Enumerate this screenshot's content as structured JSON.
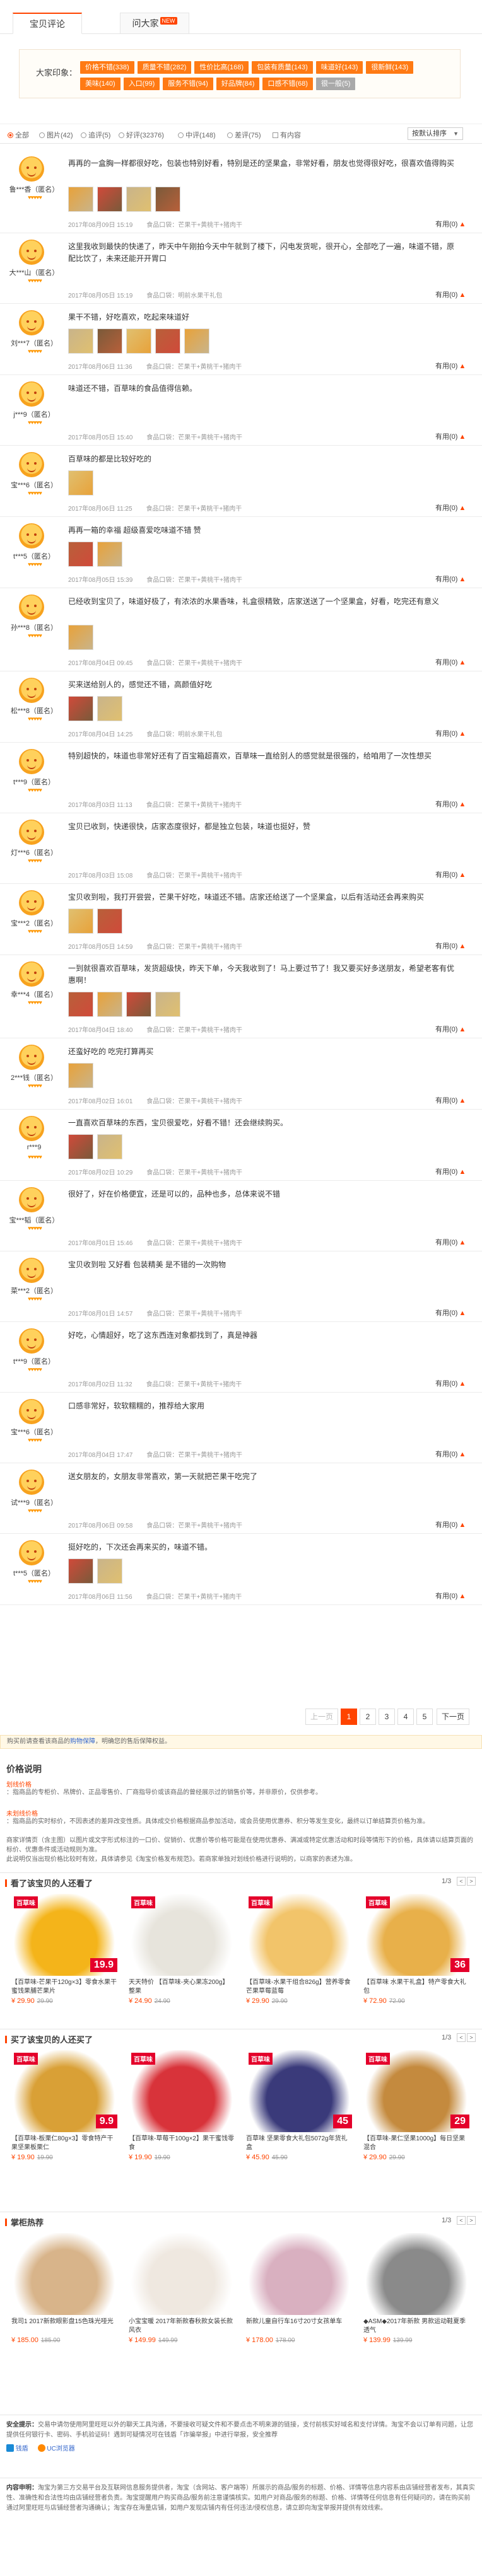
{
  "tabs": {
    "reviews": "宝贝评论",
    "rate": "问大家",
    "new_badge": "NEW"
  },
  "impression": {
    "label": "大家印象：",
    "chips": [
      {
        "text": "价格不错(338)"
      },
      {
        "text": "质量不错(282)"
      },
      {
        "text": "性价比高(168)"
      },
      {
        "text": "包装有质量(143)"
      },
      {
        "text": "味道好(143)"
      },
      {
        "text": "很新鲜(143)"
      },
      {
        "text": "美味(140)"
      },
      {
        "text": "入口(99)"
      },
      {
        "text": "服务不错(94)"
      },
      {
        "text": "好品牌(84)"
      },
      {
        "text": "口感不错(68)"
      },
      {
        "text": "很一般(5)",
        "bad": true
      }
    ]
  },
  "filter": {
    "all": "全部",
    "pic": "图片(42)",
    "append": "追评(5)",
    "good": "好评(32376)",
    "mid": "中评(148)",
    "bad": "差评(75)",
    "has_content": "有内容",
    "sort": "按默认排序"
  },
  "reviews": [
    {
      "nick": "鲁***香（匿名）",
      "text": "再再的一盒胸一样都很好吃，包装也特别好看，特别是还的坚果盒，非常好看，朋友也觉得很好吃，很喜欢值得购买",
      "photos": 4,
      "date": "2017年08月09日 15:19",
      "sku": "食品口袋：芒果干+黄桃干+猪肉干",
      "extra": "",
      "useful": "有用(0)"
    },
    {
      "nick": "大***山（匿名）",
      "text": "这里我收到最快的快递了，昨天中午刚拍今天中午就到了楼下，闪电发货呢，很开心，全部吃了一遍，味道不错，原配比饮了，未来还能开开胃口",
      "photos": 0,
      "date": "2017年08月05日 15:19",
      "sku": "食品口袋：明前水果干礼包",
      "extra": "",
      "useful": "有用(0)"
    },
    {
      "nick": "刘***7（匿名）",
      "text": "果干不错，好吃喜欢，吃起来味道好",
      "photos": 5,
      "date": "2017年08月06日 11:36",
      "sku": "食品口袋：芒果干+黄桃干+猪肉干",
      "extra": "",
      "useful": "有用(0)"
    },
    {
      "nick": "j***9（匿名）",
      "text": "味道还不错，百草味的食品值得信赖。",
      "photos": 0,
      "date": "2017年08月05日 15:40",
      "sku": "食品口袋：芒果干+黄桃干+猪肉干",
      "extra": "",
      "useful": "有用(0)"
    },
    {
      "nick": "宝***6（匿名）",
      "text": "百草味的都是比较好吃的",
      "photos": 1,
      "date": "2017年08月06日 11:25",
      "sku": "食品口袋：芒果干+黄桃干+猪肉干",
      "extra": "",
      "useful": "有用(0)"
    },
    {
      "nick": "t***5（匿名）",
      "text": "再再一箱的幸福 超级喜爱吃味道不错 赞",
      "photos": 2,
      "date": "2017年08月05日 15:39",
      "sku": "食品口袋：芒果干+黄桃干+猪肉干",
      "extra": "",
      "useful": "有用(0)"
    },
    {
      "nick": "孙***8（匿名）",
      "text": "已经收到宝贝了，味道好极了，有浓浓的水果香味，礼盒很精致，店家送送了一个坚果盒，好看，吃完还有意义",
      "photos": 1,
      "date": "2017年08月04日 09:45",
      "sku": "食品口袋：芒果干+黄桃干+猪肉干",
      "extra": "",
      "useful": "有用(0)"
    },
    {
      "nick": "松***8（匿名）",
      "text": "买来送给别人的，感觉还不错，高颜值好吃",
      "photos": 2,
      "date": "2017年08月04日 14:25",
      "sku": "食品口袋：明前水果干礼包",
      "extra": "",
      "useful": "有用(0)"
    },
    {
      "nick": "t***9（匿名）",
      "text": "特别超快的，味道也非常好还有了百宝箱超喜欢，百草味一直给别人的感觉就是很强的，给咱用了一次性想买",
      "photos": 0,
      "date": "2017年08月03日 11:13",
      "sku": "食品口袋：芒果干+黄桃干+猪肉干",
      "extra": "",
      "useful": "有用(0)"
    },
    {
      "nick": "灯***6（匿名）",
      "text": "宝贝已收到，快递很快，店家态度很好，都是独立包装，味道也挺好，赞",
      "photos": 0,
      "date": "2017年08月03日 15:08",
      "sku": "食品口袋：芒果干+黄桃干+猪肉干",
      "extra": "",
      "useful": "有用(0)"
    },
    {
      "nick": "宝***2（匿名）",
      "text": "宝贝收到啦，我打开尝尝，芒果干好吃，味道还不错。店家还给送了一个坚果盒，以后有活动还会再来购买",
      "photos": 2,
      "date": "2017年08月05日 14:59",
      "sku": "食品口袋：芒果干+黄桃干+猪肉干",
      "extra": "",
      "useful": "有用(0)"
    },
    {
      "nick": "幸***4（匿名）",
      "text": "一到就很喜欢百草味，发货超级快，昨天下单，今天我收到了！马上要过节了！我又要买好多送朋友，希望老客有优惠啊！",
      "photos": 4,
      "date": "2017年08月04日 18:40",
      "sku": "食品口袋：芒果干+黄桃干+猪肉干",
      "extra": "",
      "useful": "有用(0)"
    },
    {
      "nick": "2***钱（匿名）",
      "text": "还蛮好吃的 吃完打算再买",
      "photos": 1,
      "date": "2017年08月02日 16:01",
      "sku": "食品口袋：芒果干+黄桃干+猪肉干",
      "extra": "",
      "useful": "有用(0)"
    },
    {
      "nick": "r***9",
      "text": "一直喜欢百草味的东西，宝贝很爱吃，好看不错！还会继续购买。",
      "photos": 2,
      "date": "2017年08月02日 10:29",
      "sku": "食品口袋：芒果干+黄桃干+猪肉干",
      "extra": "",
      "useful": "有用(0)"
    },
    {
      "nick": "宝***韬（匿名）",
      "text": "很好了，好在价格便宜，还是可以的，品种也多，总体来说不错",
      "photos": 0,
      "date": "2017年08月01日 15:46",
      "sku": "食品口袋：芒果干+黄桃干+猪肉干",
      "extra": "",
      "useful": "有用(0)"
    },
    {
      "nick": "菜***2（匿名）",
      "text": "宝贝收到啦 又好看 包装精美 是不错的一次购物",
      "photos": 0,
      "date": "2017年08月01日 14:57",
      "sku": "食品口袋：芒果干+黄桃干+猪肉干",
      "extra": "",
      "useful": "有用(0)"
    },
    {
      "nick": "t***9（匿名）",
      "text": "好吃，心情超好，吃了这东西连对象都找到了，真是神器",
      "photos": 0,
      "date": "2017年08月02日 11:32",
      "sku": "食品口袋：芒果干+黄桃干+猪肉干",
      "extra": "",
      "useful": "有用(0)"
    },
    {
      "nick": "宝***6（匿名）",
      "text": "口感非常好，软软糯糯的，推荐给大家用",
      "photos": 0,
      "date": "2017年08月04日 17:47",
      "sku": "食品口袋：芒果干+黄桃干+猪肉干",
      "extra": "",
      "useful": "有用(0)"
    },
    {
      "nick": "试***9（匿名）",
      "text": "送女朋友的，女朋友非常喜欢，第一天就把芒果干吃完了",
      "photos": 0,
      "date": "2017年08月06日 09:58",
      "sku": "食品口袋：芒果干+黄桃干+猪肉干",
      "extra": "",
      "useful": "有用(0)"
    },
    {
      "nick": "t***5（匿名）",
      "text": "挺好吃的，下次还会再来买的，味道不错。",
      "photos": 2,
      "date": "2017年08月06日 11:56",
      "sku": "食品口袋：芒果干+黄桃干+猪肉干",
      "extra": "",
      "useful": "有用(0)"
    }
  ],
  "pager": {
    "prev": "上一页",
    "pages": [
      "1",
      "2",
      "3",
      "4",
      "5"
    ],
    "next": "下一页"
  },
  "notice": {
    "text": "购买前请查看该商品的",
    "link1": "购物保障",
    "mid": "，明确您的售后保障权益。"
  },
  "price_explain": {
    "title": "价格说明",
    "a_label": "划线价格",
    "a_text": "：指商品的专柜价、吊牌价、正品零售价、厂商指导价或该商品的曾经展示过的销售价等，并非原价，仅供参考。",
    "b_label": "未划线价格",
    "b_text": "：指商品的实时标价，不因表述的差异改变性质。具体成交价格根据商品参加活动，或会员使用优惠券、积分等发生变化，最终以订单结算页价格为准。",
    "c_text": "商家详情页（含主图）以图片或文字形式标注的一口价、促销价、优惠价等价格可能是在使用优惠券、满减或特定优惠活动和时段等情形下的价格，具体请以结算页面的标价、优惠条件或活动规则为准。",
    "d_text": "此说明仅当出现价格比较时有效，具体请参见《淘宝价格发布规范》。若商家单独对划线价格进行说明的，以商家的表述为准。"
  },
  "sec_viewed": {
    "title": "看了该宝贝的人还看了",
    "page": "1/3"
  },
  "viewed": [
    {
      "name": "【百草味-芒果干120g×3】零食水果干蜜饯果脯芒果片",
      "price": "¥ 29.90",
      "old": "29.90",
      "tag": "19.9",
      "bg": "#f4b41a"
    },
    {
      "name": "天天特价 【百草味-夹心果冻200g】整果",
      "price": "¥ 24.90",
      "old": "24.90",
      "tag": "",
      "bg": "#e7e4dc"
    },
    {
      "name": "【百草味-水果干组合826g】营养零食芒果草莓蓝莓",
      "price": "¥ 29.90",
      "old": "29.90",
      "tag": "",
      "bg": "#f2c46a"
    },
    {
      "name": "【百草味 水果干礼盒】特产零食大礼包",
      "price": "¥ 72.90",
      "old": "72.90",
      "tag": "36",
      "bg": "#e8b04a"
    }
  ],
  "sec_bought": {
    "title": "买了该宝贝的人还买了",
    "page": "1/3"
  },
  "bought": [
    {
      "name": "【百草味-板栗仁80g×3】零食特产干果坚果板栗仁",
      "price": "¥ 19.90",
      "old": "19.90",
      "tag": "9.9",
      "bg": "#d9a036"
    },
    {
      "name": "【百草味-草莓干100g×2】果干蜜饯零食",
      "price": "¥ 19.90",
      "old": "19.90",
      "tag": "",
      "bg": "#d8333a"
    },
    {
      "name": "百草味 坚果零食大礼包5072g年货礼盒",
      "price": "¥ 45.90",
      "old": "45.90",
      "tag": "45",
      "bg": "#3a3a7a"
    },
    {
      "name": "【百草味-果仁坚果1000g】每日坚果混合",
      "price": "¥ 29.90",
      "old": "29.90",
      "tag": "29",
      "bg": "#c48a3e"
    }
  ],
  "sec_hot": {
    "title": "掌柜热荐",
    "page": "1/3"
  },
  "hot": [
    {
      "name": "我司1 2017新款眼影盘15色珠光哑光",
      "price": "¥ 185.00",
      "old": "185.00",
      "bg": "#d8b48a"
    },
    {
      "name": "小宝宝暖 2017年新款春秋款女装长款风衣",
      "price": "¥ 149.99",
      "old": "149.99",
      "bg": "#efe8e0"
    },
    {
      "name": "新款儿童自行车16寸20寸女孩单车",
      "price": "¥ 178.00",
      "old": "178.00",
      "bg": "#d9b0c0"
    },
    {
      "name": "◆ASM◆2017年新款 男款运动鞋夏季透气",
      "price": "¥ 139.99",
      "old": "139.99",
      "bg": "#8a8a8a"
    }
  ],
  "footer": {
    "safe_label": "安全提示：",
    "safe_text": "交易中请勿使用阿里旺旺以外的聊天工具沟通，不要接收可疑文件和不要点击不明来源的链接，支付前核实好域名和支付详情。淘宝不会以订单有问题，让您提供任何银行卡、密码、手机验证码！遇到可疑情况可在钱盾「诈骗举报」中进行举报，安全推荐",
    "app1": "钱盾",
    "app2": "UC浏览器",
    "content_label": "内容申明：",
    "content_text": "淘宝为第三方交易平台及互联网信息服务提供者，淘宝（含网站、客户端等）所展示的商品/服务的标题、价格、详情等信息内容系由店铺经营者发布，其真实性、准确性和合法性均由店铺经营者负责。淘宝提醒用户购买商品/服务前注意谨慎核实。如用户对商品/服务的标题、价格、详情等任何信息有任何疑问的，请在购买前通过阿里旺旺与店铺经营者沟通确认；淘宝存在海量店铺，如用户发现店铺内有任何违法/侵权信息，请立即向淘宝举报并提供有效线索。"
  }
}
